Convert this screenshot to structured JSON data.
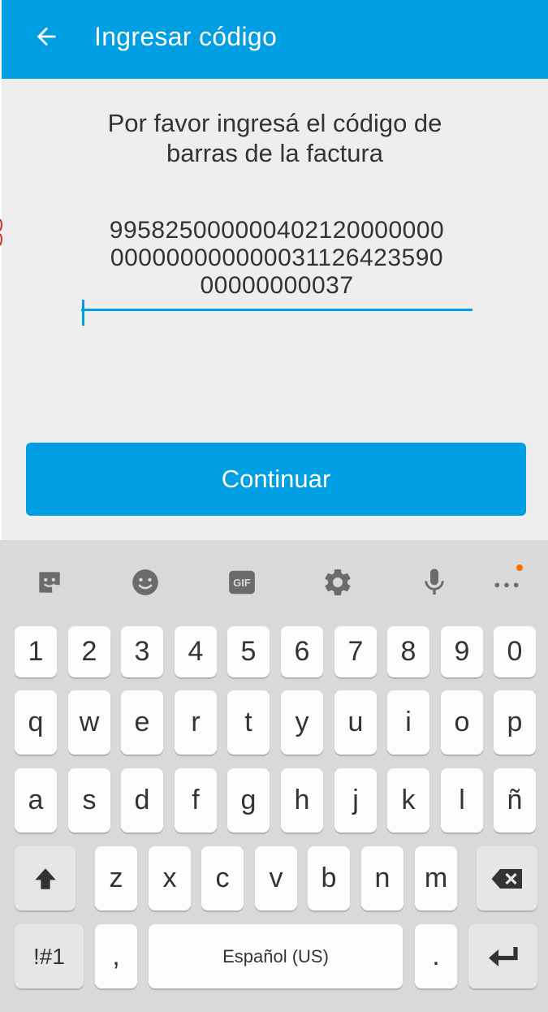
{
  "appbar": {
    "title": "Ingresar código",
    "back_icon": "arrow-back-icon"
  },
  "colors": {
    "primary": "#009ee3",
    "background": "#eeeeee",
    "keyboard_bg": "#d9d9d9",
    "dot": "#ff6d00"
  },
  "main": {
    "instruction_line1": "Por favor ingresá el código de",
    "instruction_line2": "barras de la factura",
    "code_line1": "995825000000402120000000",
    "code_line2": "000000000000031126423590",
    "code_line3": "00000000037",
    "continue_label": "Continuar"
  },
  "keyboard": {
    "toolbar_icons": [
      "sticker-icon",
      "emoji-icon",
      "gif-icon",
      "settings-icon",
      "mic-icon",
      "more-icon"
    ],
    "gif_label": "GIF",
    "row_numbers": [
      "1",
      "2",
      "3",
      "4",
      "5",
      "6",
      "7",
      "8",
      "9",
      "0"
    ],
    "row1": [
      "q",
      "w",
      "e",
      "r",
      "t",
      "y",
      "u",
      "i",
      "o",
      "p"
    ],
    "row2": [
      "a",
      "s",
      "d",
      "f",
      "g",
      "h",
      "j",
      "k",
      "l",
      "ñ"
    ],
    "row3": [
      "z",
      "x",
      "c",
      "v",
      "b",
      "n",
      "m"
    ],
    "symbols_label": "!#1",
    "comma_label": ",",
    "space_label": "Español (US)",
    "period_label": "."
  }
}
